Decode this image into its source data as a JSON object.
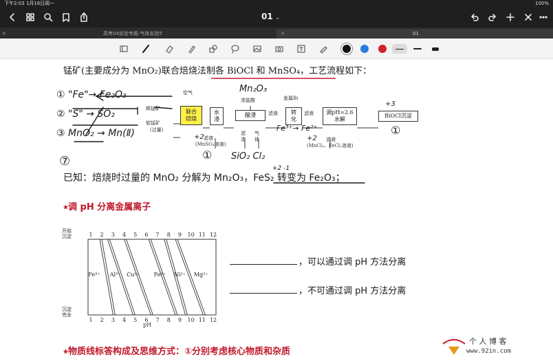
{
  "status": {
    "time_date": "下午2:03  1月16日周一",
    "battery": "100%"
  },
  "navbar": {
    "title": "01",
    "title_chev": "⌄"
  },
  "tabs": [
    {
      "label": "高考04实验专题-气体实验5",
      "active": false
    },
    {
      "label": "01",
      "active": true
    }
  ],
  "toolbar": {
    "tools": [
      "sidebar-icon",
      "pen-icon",
      "eraser-icon",
      "highlighter-icon",
      "shapes-icon",
      "lasso-icon",
      "image-icon",
      "camera-icon",
      "text-icon",
      "ruler-pen-icon"
    ],
    "colors": [
      "#111111",
      "#2a7de1",
      "#d0242a"
    ]
  },
  "content": {
    "intro": "锰矿(主要成分为 MnO₂)联合焙烧法制各 BiOCl 和 MnSO₄，工艺流程如下：",
    "flow": {
      "air": "空气",
      "ore1": "辉铋矿",
      "ore2": "软锰矿",
      "ore2_note": "(过量)",
      "box_roast": "联合\n焙烧",
      "box_leach_water": "水\n浸",
      "filtrate_note": "滤液",
      "filtrate_sub": "(MnSO₄溶液)",
      "reagent_conc_hcl": "浓盐酸",
      "box_acid_leach": "酸浸",
      "residue": "滤渣",
      "gas": "气体",
      "filtrate2": "滤液",
      "reagent_bi": "金属Bi",
      "box_transform": "转\n化",
      "filtrate3": "滤液",
      "box_ph": "调pH=2.6\n水解",
      "filtrate4": "滤液",
      "filtrate4_sub": "(MnCl₂、FeCl₂溶液)",
      "box_product": "BiOCl沉淀"
    },
    "handwriting": {
      "h1": "① \"Fe\"→ Fe₂O₃",
      "h2": "② \"S\" → SO₂",
      "h3": "③ MnO₂ → Mn(Ⅱ)",
      "h_mn2o3": "Mn₂O₃",
      "h_fe": "Fe³⁺→ Fe²⁺",
      "h_plus3": "+3",
      "h_plus2": "+2",
      "h_plus2b": "+2",
      "h_circle1": "①",
      "h_circle2": "①",
      "h_sio2": "SiO₂  Cl₂",
      "h_circle7": "⑦",
      "h_charges": "+2  -1"
    },
    "known": "已知：焙烧时过量的 MnO₂ 分解为 Mn₂O₃，FeS₂ 转变为 Fe₂O₃；",
    "section1": "⭑调 pH 分离金属离子",
    "ph_chart": {
      "top_label": "开始\n沉淀",
      "bottom_label": "沉淀\n完全",
      "ticks": [
        "1",
        "2",
        "3",
        "4",
        "5",
        "6",
        "7",
        "8",
        "9",
        "10",
        "11",
        "12"
      ],
      "ions": [
        "Fe³⁺",
        "Al³⁺",
        "Cu²⁺",
        "Fe²⁺",
        "Ni²⁺",
        "Mg²⁺"
      ],
      "axis_label": "pH"
    },
    "q1": "，可以通过调 pH 方法分离",
    "q2": "，不可通过调 pH 方法分离",
    "section2": "⭑物质线标答构成及思维方式：①分别考虑核心物质和杂质"
  },
  "watermark": {
    "cn": "个 人 博 客",
    "url": "www.92in.com"
  }
}
